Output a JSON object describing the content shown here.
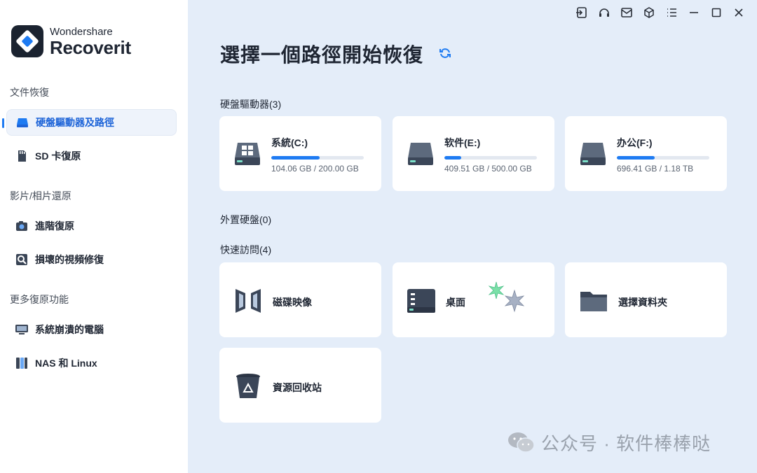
{
  "app": {
    "brand": "Wondershare",
    "product": "Recoverit"
  },
  "sidebar": {
    "sections": [
      {
        "title": "文件恢復",
        "items": [
          {
            "label": "硬盤驅動器及路徑",
            "icon": "hard-drive-icon",
            "active": true
          },
          {
            "label": "SD 卡復原",
            "icon": "sd-card-icon",
            "active": false
          }
        ]
      },
      {
        "title": "影片/相片還原",
        "items": [
          {
            "label": "進階復原",
            "icon": "camera-icon",
            "active": false
          },
          {
            "label": "損壞的視頻修復",
            "icon": "video-repair-icon",
            "active": false
          }
        ]
      },
      {
        "title": "更多復原功能",
        "items": [
          {
            "label": "系統崩潰的電腦",
            "icon": "computer-icon",
            "active": false
          },
          {
            "label": "NAS 和 Linux",
            "icon": "nas-icon",
            "active": false
          }
        ]
      }
    ]
  },
  "titlebar": {
    "buttons": [
      "login-icon",
      "headset-icon",
      "mail-icon",
      "cube-icon",
      "menu-icon",
      "minimize-icon",
      "maximize-icon",
      "close-icon"
    ]
  },
  "main": {
    "title": "選擇一個路徑開始恢復",
    "hard_drives": {
      "label": "硬盤驅動器(3)",
      "drives": [
        {
          "name": "系統(C:)",
          "size": "104.06 GB / 200.00 GB",
          "used_fraction": 0.52,
          "icon": "windows-drive-icon"
        },
        {
          "name": "软件(E:)",
          "size": "409.51 GB / 500.00 GB",
          "used_fraction": 0.18,
          "icon": "drive-icon"
        },
        {
          "name": "办公(F:)",
          "size": "696.41 GB / 1.18 TB",
          "used_fraction": 0.41,
          "icon": "drive-icon"
        }
      ]
    },
    "external": {
      "label": "外置硬盤(0)"
    },
    "quick_access": {
      "label": "快速訪問(4)",
      "items": [
        {
          "name": "磁碟映像",
          "icon": "disk-image-icon"
        },
        {
          "name": "桌面",
          "icon": "desktop-icon"
        },
        {
          "name": "選擇資料夾",
          "icon": "folder-icon"
        },
        {
          "name": "資源回收站",
          "icon": "recycle-bin-icon"
        }
      ]
    }
  },
  "watermark": {
    "text": "公众号 · 软件棒棒哒"
  },
  "colors": {
    "accent": "#1e7bf2",
    "main_bg": "#e4edf9",
    "sidebar_bg": "#ffffff",
    "text": "#1f2633"
  }
}
